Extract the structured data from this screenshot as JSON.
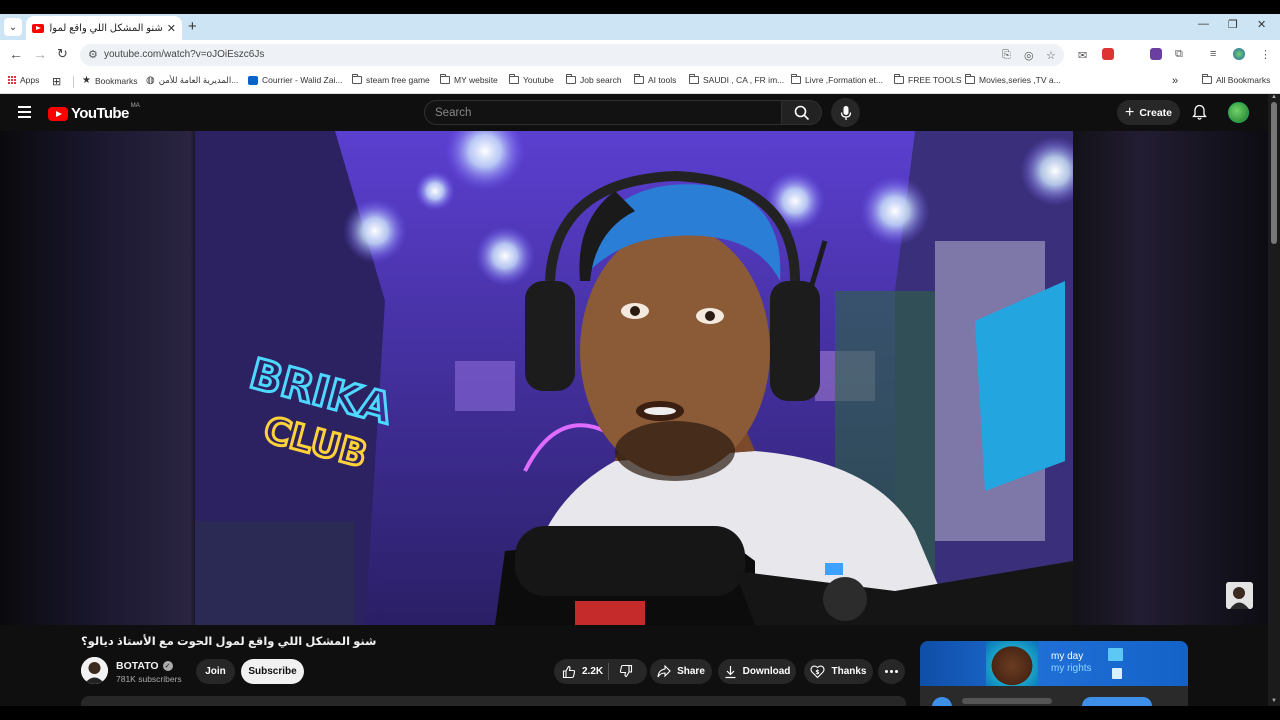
{
  "browser": {
    "tab_title": "شنو المشكل اللي واقع لمول الحو...",
    "url": "youtube.com/watch?v=oJOiEszc6Js",
    "bookmarks": [
      {
        "label": "Apps",
        "icon": "apps-grid-icon"
      },
      {
        "label": "Bookmarks",
        "icon": "star-icon"
      },
      {
        "label": "المديرية العامة للأمن...",
        "icon": "globe-icon"
      },
      {
        "label": "Courrier - Walid Zai...",
        "icon": "outlook-icon"
      },
      {
        "label": "steam free game",
        "icon": "folder-icon"
      },
      {
        "label": "MY website",
        "icon": "folder-icon"
      },
      {
        "label": "Youtube",
        "icon": "folder-icon"
      },
      {
        "label": "Job search",
        "icon": "folder-icon"
      },
      {
        "label": "AI tools",
        "icon": "folder-icon"
      },
      {
        "label": "SAUDI , CA , FR im...",
        "icon": "folder-icon"
      },
      {
        "label": "Livre ,Formation et...",
        "icon": "folder-icon"
      },
      {
        "label": "FREE TOOLS",
        "icon": "folder-icon"
      },
      {
        "label": "Movies,series ,TV a...",
        "icon": "folder-icon"
      }
    ],
    "all_bookmarks": "All Bookmarks"
  },
  "youtube": {
    "logo_text": "YouTube",
    "country_code": "MA",
    "search_placeholder": "Search",
    "create_label": "Create"
  },
  "video": {
    "title": "شنو المشكل اللي واقع لمول الحوت مع الأستاذ ديالو؟",
    "channel_name": "BOTATO",
    "subscribers": "781K subscribers",
    "join_label": "Join",
    "subscribe_label": "Subscribe",
    "like_count": "2.2K",
    "share_label": "Share",
    "download_label": "Download",
    "thanks_label": "Thanks"
  },
  "ad": {
    "line1": "my day",
    "line2": "my rights"
  },
  "colors": {
    "yt_red": "#ff0000",
    "yt_bg": "#0f0f0f",
    "tabbar": "#cde4f5"
  }
}
